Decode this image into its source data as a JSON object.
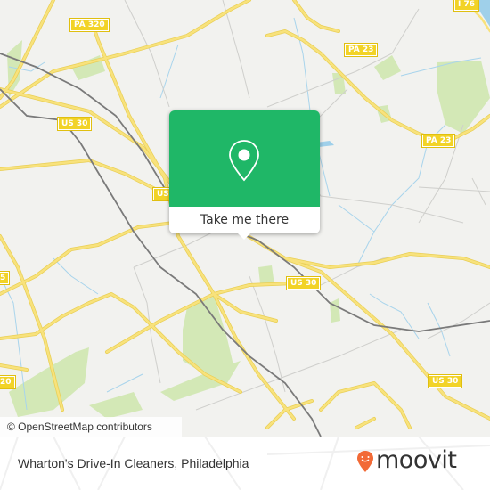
{
  "map": {
    "road_labels": [
      {
        "name": "PA 320",
        "id": "pa320-top"
      },
      {
        "name": "US 30",
        "id": "us30-left"
      },
      {
        "name": "US 30",
        "id": "us30-center"
      },
      {
        "name": "US 30",
        "id": "us30-mid"
      },
      {
        "name": "US 30",
        "id": "us30-right"
      },
      {
        "name": "PA 23",
        "id": "pa23-top"
      },
      {
        "name": "PA 23",
        "id": "pa23-right"
      },
      {
        "name": "I 76",
        "id": "i76"
      },
      {
        "name": "5",
        "id": "left-edge-1"
      },
      {
        "name": "20",
        "id": "left-edge-2"
      }
    ],
    "attribution": "© OpenStreetMap contributors",
    "colors": {
      "background": "#f2f2ef",
      "major_road": "#f5dc6b",
      "park": "#cfe6b0",
      "water": "#9fd0ea",
      "rail": "#777777",
      "minor_road": "#c8c8c8"
    }
  },
  "popup": {
    "button_label": "Take me there",
    "icon": "map-pin-icon",
    "color": "#1fb767"
  },
  "footer": {
    "place_title": "Wharton's Drive-In Cleaners, Philadelphia",
    "brand": "moovit",
    "brand_color": "#f26a36"
  }
}
